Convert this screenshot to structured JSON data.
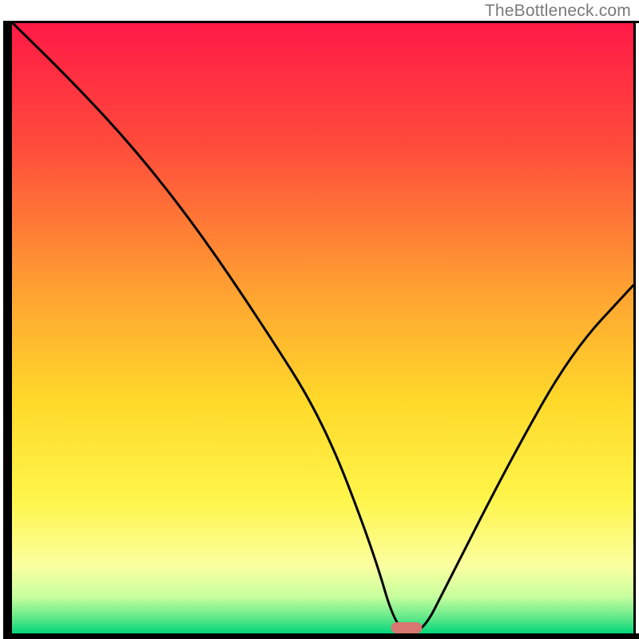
{
  "watermark": "TheBottleneck.com",
  "chart_data": {
    "type": "line",
    "title": "",
    "xlabel": "",
    "ylabel": "",
    "xlim": [
      0,
      100
    ],
    "ylim": [
      0,
      100
    ],
    "x": [
      0,
      10,
      20,
      30,
      40,
      50,
      58,
      62,
      66,
      70,
      80,
      90,
      100
    ],
    "values": [
      100,
      90,
      79,
      66,
      51,
      35,
      14,
      0,
      0,
      8,
      28,
      46,
      57
    ],
    "optimal_marker": {
      "x_start": 61,
      "x_end": 66,
      "y": 0
    },
    "gradient_stops": [
      {
        "offset": 0.0,
        "color": "#ff1946"
      },
      {
        "offset": 0.2,
        "color": "#ff4b3b"
      },
      {
        "offset": 0.45,
        "color": "#ffa531"
      },
      {
        "offset": 0.62,
        "color": "#ffd92a"
      },
      {
        "offset": 0.78,
        "color": "#fff54a"
      },
      {
        "offset": 0.89,
        "color": "#fbffa0"
      },
      {
        "offset": 0.94,
        "color": "#c7ff9e"
      },
      {
        "offset": 0.975,
        "color": "#5fe889"
      },
      {
        "offset": 1.0,
        "color": "#00d67a"
      }
    ],
    "marker_color": "#d8766f",
    "border_color": "#000000"
  }
}
